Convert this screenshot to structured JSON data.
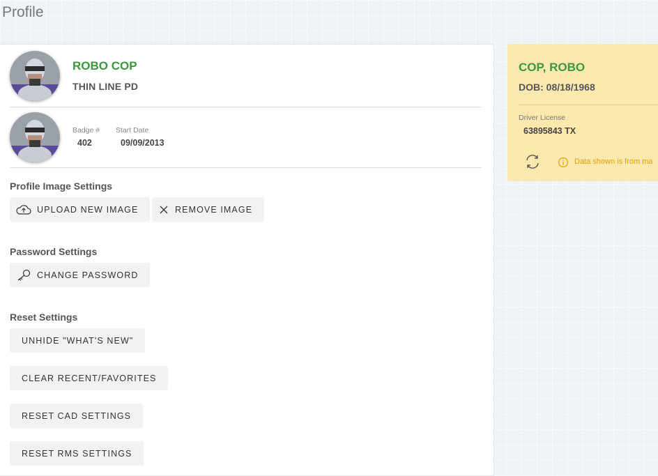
{
  "page": {
    "title": "Profile"
  },
  "profile": {
    "name": "ROBO COP",
    "agency": "THIN LINE PD",
    "badge_label": "Badge #",
    "badge_value": "402",
    "start_date_label": "Start Date",
    "start_date_value": "09/09/2013"
  },
  "image_settings": {
    "title": "Profile Image Settings",
    "upload_label": "UPLOAD NEW IMAGE",
    "remove_label": "REMOVE IMAGE"
  },
  "password_settings": {
    "title": "Password Settings",
    "change_label": "CHANGE PASSWORD"
  },
  "reset_settings": {
    "title": "Reset Settings",
    "unhide_label": "UNHIDE \"WHAT'S NEW\"",
    "clear_label": "CLEAR RECENT/FAVORITES",
    "reset_cad_label": "RESET CAD SETTINGS",
    "reset_rms_label": "RESET RMS SETTINGS"
  },
  "person_card": {
    "name": "COP, ROBO",
    "dob": "DOB: 08/18/1968",
    "license_label": "Driver License",
    "license_value": "63895843 TX",
    "info_text": "Data shown is from ma"
  },
  "colors": {
    "accent_green": "#3a9a3a",
    "card_yellow": "#fde9ad",
    "info_orange": "#e0a000"
  },
  "icons": [
    "cloud-upload-icon",
    "close-icon",
    "key-icon",
    "refresh-icon",
    "info-icon"
  ]
}
